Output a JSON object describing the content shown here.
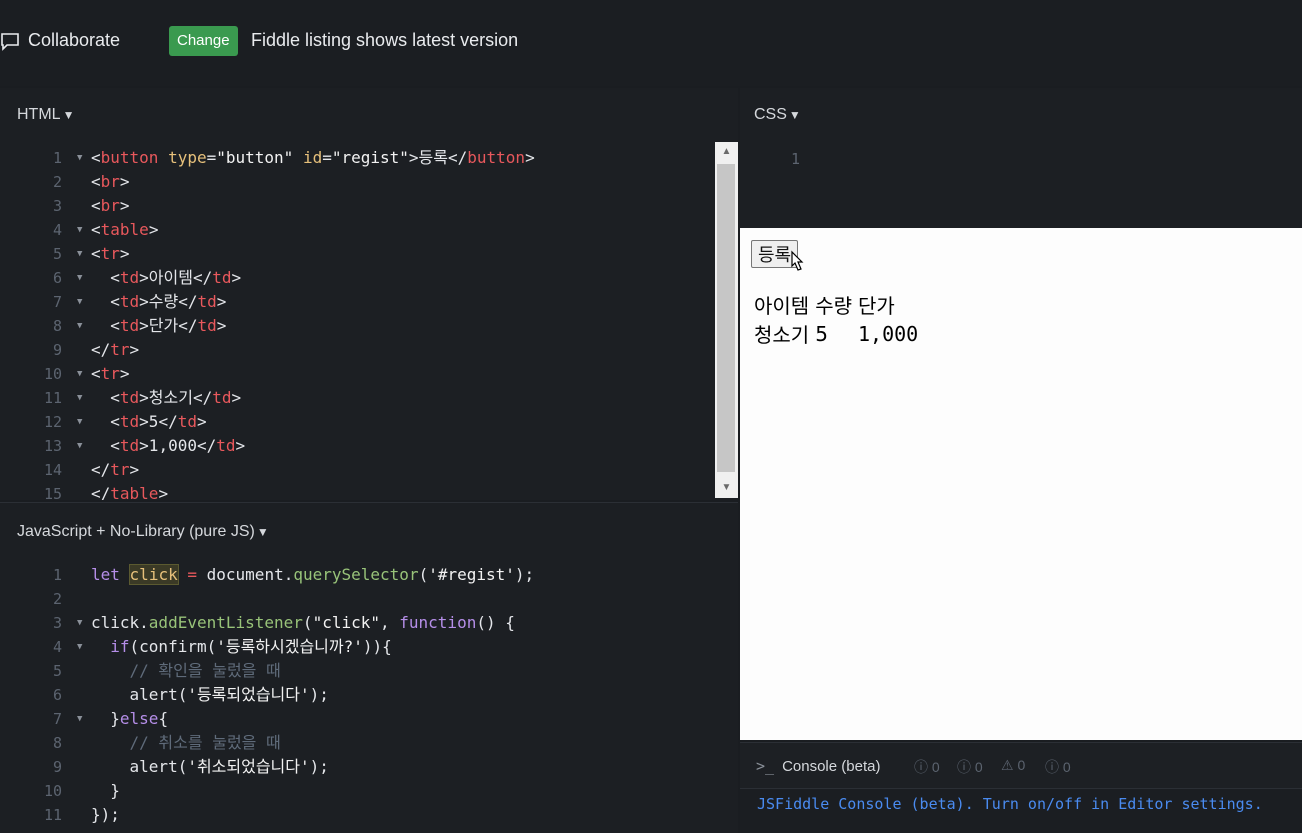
{
  "topbar": {
    "collaborate_label": "Collaborate",
    "change_label": "Change",
    "listing_text": "Fiddle listing shows latest version"
  },
  "html_pane": {
    "title": "HTML",
    "line_numbers": [
      "1",
      "2",
      "3",
      "4",
      "5",
      "6",
      "7",
      "8",
      "9",
      "10",
      "11",
      "12",
      "13",
      "14",
      "15"
    ]
  },
  "css_pane": {
    "title": "CSS",
    "line_numbers": [
      "1"
    ]
  },
  "js_pane": {
    "title": "JavaScript + No-Library (pure JS)",
    "line_numbers": [
      "1",
      "2",
      "3",
      "4",
      "5",
      "6",
      "7",
      "8",
      "9",
      "10",
      "11"
    ]
  },
  "result": {
    "button_label": "등록",
    "rows": [
      [
        "아이템",
        "수량",
        "단가"
      ],
      [
        "청소기",
        "5",
        "1,000"
      ]
    ]
  },
  "console": {
    "title": "Console (beta)",
    "prompt": ">_",
    "counts": [
      "0",
      "0",
      "0",
      "0"
    ],
    "message": "JSFiddle Console (beta). Turn on/off in Editor settings."
  },
  "colors": {
    "change_button": "#3a9a4f",
    "tag": "#e8585c",
    "attr": "#e6c07b",
    "keyword": "#b58ee8",
    "function": "#98c379",
    "comment": "#5f6b7a",
    "console_message": "#4a8bf0"
  }
}
